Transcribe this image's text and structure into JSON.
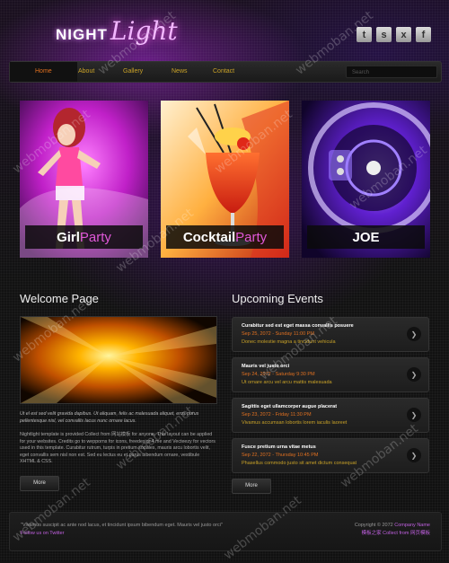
{
  "logo": {
    "part1": "NIGHT",
    "part2": "Light"
  },
  "social": [
    "t",
    "s",
    "x",
    "f"
  ],
  "nav": {
    "items": [
      "Home",
      "About",
      "Gallery",
      "News",
      "Contact"
    ],
    "search_placeholder": "Search"
  },
  "banners": [
    {
      "title": "Girl",
      "accent": "Party"
    },
    {
      "title": "Cocktail",
      "accent": "Party"
    },
    {
      "title": "JOE",
      "accent": ""
    }
  ],
  "welcome": {
    "title": "Welcome Page",
    "intro": "Ut el est sed velit gravida dapibus. Ut aliquam, felis ac malesuada aliquet, eros purus pellentesque nisl, vel convallis lacus nunc ornare lacus.",
    "body": "Nightlight template is provided Collect from 网站模板 for anyone. This layout can be applied for your websites. Credits go to wepporns for icons, freedesign4.me and Vecteezy for vectors used in this template. Curabitur rutrum, turpis in pretium sodales, mauris arcu lobortis velit, eget convallis sem nisl non est. Sed eu lectus eu et purus bibendum ornare, vestibule XHTML & CSS.",
    "more": "More"
  },
  "events": {
    "title": "Upcoming Events",
    "items": [
      {
        "title": "Curabitur sed est eget massa convallis posuere",
        "date": "Sep 25, 2072 - Sunday 11:00 PM",
        "text": "Donec molestie magna a tincidunt vehicula"
      },
      {
        "title": "Mauris vel justo orci",
        "date": "Sep 24, 2072 - Saturday 9:30 PM",
        "text": "Ut ornare arcu vel arcu mattis malesuada"
      },
      {
        "title": "Sagittis eget ullamcorper augue placerat",
        "date": "Sep 23, 2072 - Friday 11:30 PM",
        "text": "Vivamus accumsan lobortis lorem iaculis laoreet"
      },
      {
        "title": "Fusce pretium urna vitae metus",
        "date": "Sep 22, 2072 - Thursday 10:45 PM",
        "text": "Phasellus commodo justo sit amet dictum consequat"
      }
    ],
    "more": "More"
  },
  "footer": {
    "quote": "\"Vivamus suscipit ac ante nod lacus, et tincidunt ipsum bibendum eget. Mauris vel justo orci\"",
    "follow": "Follow us on Twitter",
    "copyright": "Copyright © 2072",
    "company": "Company Name",
    "credit": "模板之家 Collect from 网页模板"
  },
  "watermark": "webmoban.net",
  "colors": {
    "accent_orange": "#e07020",
    "accent_gold": "#c9a227",
    "accent_pink": "#e058d8"
  }
}
